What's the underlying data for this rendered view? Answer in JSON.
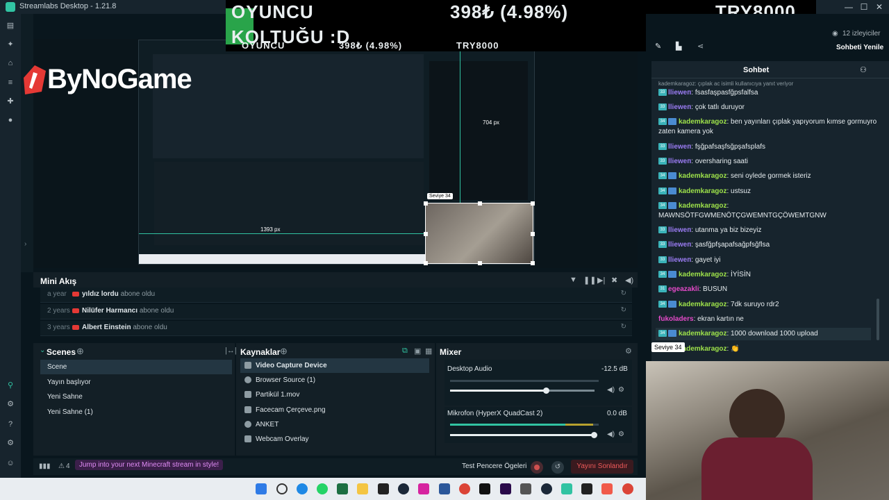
{
  "window": {
    "app_title": "Streamlabs Desktop - 1.21.8",
    "minimize": "—",
    "maximize": "☐",
    "close": "✕"
  },
  "overlay": {
    "name_line1": "OYUNCU",
    "name_line2": "KOLTUĞU :D",
    "price": "398₺ (4.98%)",
    "goal": "TRY8000",
    "brand": "ByNoGame"
  },
  "preview": {
    "dim_width": "1393 px",
    "dim_height": "704 px",
    "tooltip": "Seviye 34"
  },
  "mini_feed": {
    "title": "Mini Akış",
    "events": [
      {
        "time": "a year",
        "name": "yıldız lordu",
        "action": "abone oldu"
      },
      {
        "time": "2 years",
        "name": "Nilüfer Harmancı",
        "action": "abone oldu"
      },
      {
        "time": "3 years",
        "name": "Albert Einstein",
        "action": "abone oldu"
      }
    ]
  },
  "scenes": {
    "title": "Scenes",
    "items": [
      "Scene",
      "Yayın başlıyor",
      "Yeni Sahne",
      "Yeni Sahne (1)"
    ]
  },
  "sources": {
    "title": "Kaynaklar",
    "items": [
      "Video Capture Device",
      "Browser Source (1)",
      "Partikül 1.mov",
      "Facecam Çerçeve.png",
      "ANKET",
      "Webcam Overlay"
    ]
  },
  "mixer": {
    "title": "Mixer",
    "channels": [
      {
        "name": "Desktop Audio",
        "db": "-12.5 dB",
        "level": 0.0,
        "volume": 0.66
      },
      {
        "name": "Mikrofon (HyperX QuadCast 2)",
        "db": "0.0 dB",
        "level": 0.8,
        "volume": 1.0
      }
    ]
  },
  "bottombar": {
    "promo": "Jump into your next Minecraft stream in style!",
    "test_label": "Test Pencere Ögeleri",
    "end_label": "Yayını Sonlandır",
    "alert_count": "4"
  },
  "right": {
    "viewers": "12 izleyiciler",
    "refresh": "Sohbeti Yenile",
    "chat_title": "Sohbet",
    "reply_line": "kademkaragoz: çıplak ac isimli kullanıcıya yanıt veriyor",
    "messages": [
      {
        "badge": "33",
        "user": "llieweп",
        "text": "fsasfaşpasfğpsfalfsa",
        "color": "p"
      },
      {
        "badge": "33",
        "user": "llieweп",
        "text": "çok tatlı duruyor",
        "color": "p"
      },
      {
        "badge": "34",
        "user": "kademkaragoz",
        "text": "ben yayınları çıplak yapıyorum kımse gormuyro zaten kamera yok",
        "color": "g"
      },
      {
        "badge": "33",
        "user": "llieweп",
        "text": "fşğpafsaşfsğpşafsplafs",
        "color": "p"
      },
      {
        "badge": "33",
        "user": "llieweп",
        "text": "oversharing saati",
        "color": "p"
      },
      {
        "badge": "34",
        "user": "kademkaragoz",
        "text": "seni oylede gormek isteriz",
        "color": "g"
      },
      {
        "badge": "34",
        "user": "kademkaragoz",
        "text": "ustsuz",
        "color": "g"
      },
      {
        "badge": "34",
        "user": "kademkaragoz",
        "text": "MAWNSÖTFGWMENÖTÇGWEMNTGÇÖWEMTGNW",
        "color": "g"
      },
      {
        "badge": "33",
        "user": "llieweп",
        "text": "utanma ya biz bizeyiz",
        "color": "p"
      },
      {
        "badge": "33",
        "user": "llieweп",
        "text": "şasfğpfşapafsağpfsğflsa",
        "color": "p"
      },
      {
        "badge": "33",
        "user": "llieweп",
        "text": "gayet iyi",
        "color": "p"
      },
      {
        "badge": "34",
        "user": "kademkaragoz",
        "text": "İYİSİN",
        "color": "g"
      },
      {
        "badge": "31",
        "user": "egeazakli",
        "text": "BUSUN",
        "color": "m"
      },
      {
        "badge": "34",
        "user": "kademkaragoz",
        "text": "7dk suruyo rdr2",
        "color": "g"
      },
      {
        "badge": "",
        "user": "fukoladers",
        "text": "ekran kartın ne",
        "color": "m"
      },
      {
        "badge": "34",
        "user": "kademkaragoz",
        "text": "1000 download 1000 upload",
        "color": "g"
      },
      {
        "badge": "34",
        "user": "kademkaragoz",
        "text": "👏",
        "color": "g"
      }
    ]
  }
}
